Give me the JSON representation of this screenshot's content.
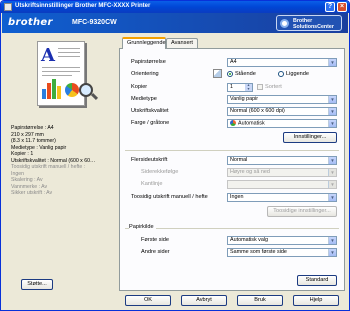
{
  "window": {
    "title": "Utskriftsinnstillinger Brother MFC-XXXX Printer",
    "help": "?",
    "close": "×"
  },
  "banner": {
    "logo": "brother",
    "model": "MFC-9320CW",
    "sc_line1": "Brother",
    "sc_line2": "SolutionsCenter"
  },
  "preview": {
    "letter": "A"
  },
  "summary": {
    "line1": "Papirstørrelse : A4",
    "line2": "210 x 297 mm",
    "line3": "(8.3 x 11.7 tommer)",
    "line4": "Medietype : Vanlig papir",
    "line5": "Kopier : 1",
    "line6": "Utskriftskvalitet : Normal (600 x 60…",
    "line7": "Toosidig utskrift manuell / hefte :",
    "line8": "Ingen",
    "line9": "Skalering : Av",
    "line10": "Vannmerke : Av",
    "line11": "Sikker utskrift : Av"
  },
  "support_button": "Støtte...",
  "tabs": [
    "Grunnleggende",
    "Avansert"
  ],
  "basic": {
    "paper_size_label": "Papirstørrelse",
    "paper_size_value": "A4",
    "orientation_label": "Orientering",
    "portrait_label": "Stående",
    "landscape_label": "Liggende",
    "copies_label": "Kopier",
    "copies_value": "1",
    "collate_label": "Sortert",
    "media_label": "Medietype",
    "media_value": "Vanlig papir",
    "quality_label": "Utskriftskvalitet",
    "quality_value": "Normal (600 x 600 dpi)",
    "color_label": "Farge / gråtone",
    "color_value": "Automatisk",
    "settings_button": "Innstillinger...",
    "multipage_label": "Flersideutskrift",
    "multipage_value": "Normal",
    "page_order_label": "Siderekkefølge",
    "page_order_value": "Høyre og så ned",
    "border_label": "Kantlinje",
    "duplex_label": "Toosidig utskrift manuell / hefte",
    "duplex_value": "Ingen",
    "duplex_settings_button": "Toosidige innstillinger...",
    "source_group": "Papirkilde",
    "first_page_label": "Første side",
    "first_page_value": "Automatisk valg",
    "other_pages_label": "Andre sider",
    "other_pages_value": "Samme som første side",
    "default_button": "Standard"
  },
  "footer": {
    "ok": "OK",
    "cancel": "Avbryt",
    "apply": "Bruk",
    "help": "Hjelp"
  }
}
